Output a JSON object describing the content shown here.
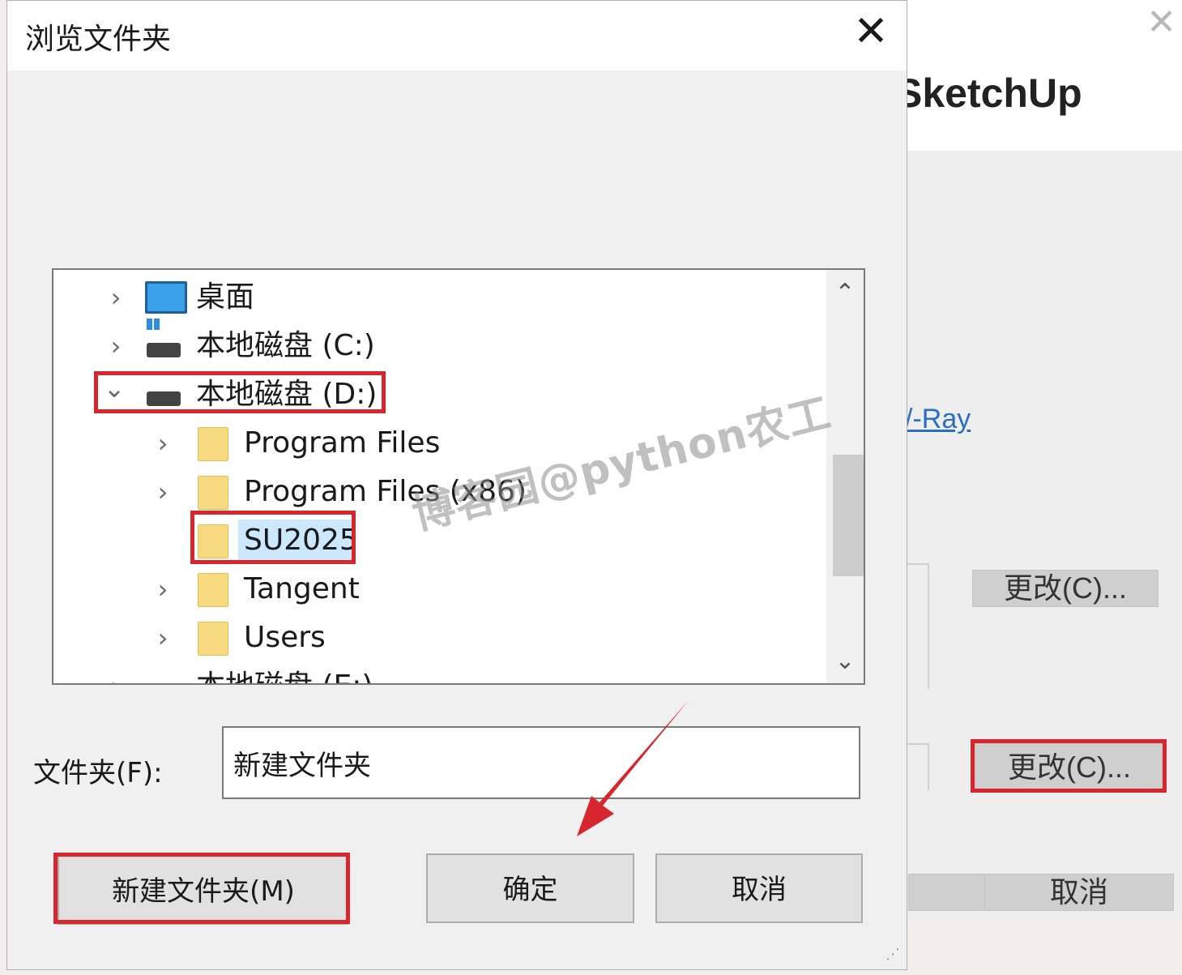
{
  "background_window": {
    "title": "SketchUp",
    "link_text": "/-Ray",
    "change_button_1": "更改(C)...",
    "change_button_2": "更改(C)...",
    "cancel_button": "取消"
  },
  "dialog": {
    "title": "浏览文件夹",
    "close_glyph": "✕",
    "tree": {
      "items": [
        {
          "label": "桌面",
          "icon": "desktop-icon",
          "expander": "›"
        },
        {
          "label": "本地磁盘 (C:)",
          "icon": "drive-c-icon",
          "expander": "›"
        },
        {
          "label": "本地磁盘 (D:)",
          "icon": "drive-icon",
          "expander": "⌄",
          "expanded": true
        },
        {
          "label": "Program Files",
          "icon": "folder-icon",
          "expander": "›"
        },
        {
          "label": "Program Files (x86)",
          "icon": "folder-icon",
          "expander": "›"
        },
        {
          "label": "SU2025",
          "icon": "folder-icon",
          "expander": "",
          "selected": true
        },
        {
          "label": "Tangent",
          "icon": "folder-icon",
          "expander": "›"
        },
        {
          "label": "Users",
          "icon": "folder-icon",
          "expander": "›"
        },
        {
          "label": "本地磁盘 (E:)",
          "icon": "drive-icon",
          "expander": "›"
        }
      ],
      "scroll_up": "⌃",
      "scroll_down": "⌄"
    },
    "folder_field_label": "文件夹(F):",
    "folder_field_value": "新建文件夹",
    "buttons": {
      "new_folder": "新建文件夹(M)",
      "ok": "确定",
      "cancel": "取消"
    },
    "resize_glyph": "⋰"
  },
  "watermark": "博客园@python农工",
  "colors": {
    "highlight": "#d8262e",
    "link": "#2a6fc0",
    "folder": "#f7d980",
    "selection": "#cce8ff"
  }
}
